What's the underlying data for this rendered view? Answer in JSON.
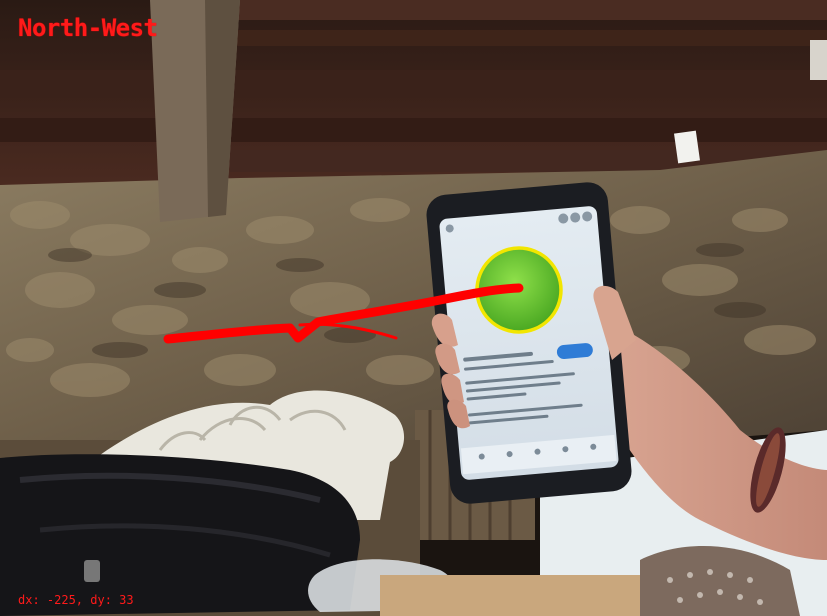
{
  "overlay": {
    "direction_label": "North-West",
    "motion_readout": "dx: -225, dy: 33",
    "text_color": "#ff1a1a",
    "trail_color": "#ff0000"
  },
  "marker": {
    "fill_color": "#5cc22a",
    "ring_color": "#f2e600"
  },
  "scene": {
    "subject": "hand holding smartphone showing green circle target",
    "setting": "stone wall with wooden ceiling beams",
    "foreground": "black bag on white ornate bench"
  }
}
